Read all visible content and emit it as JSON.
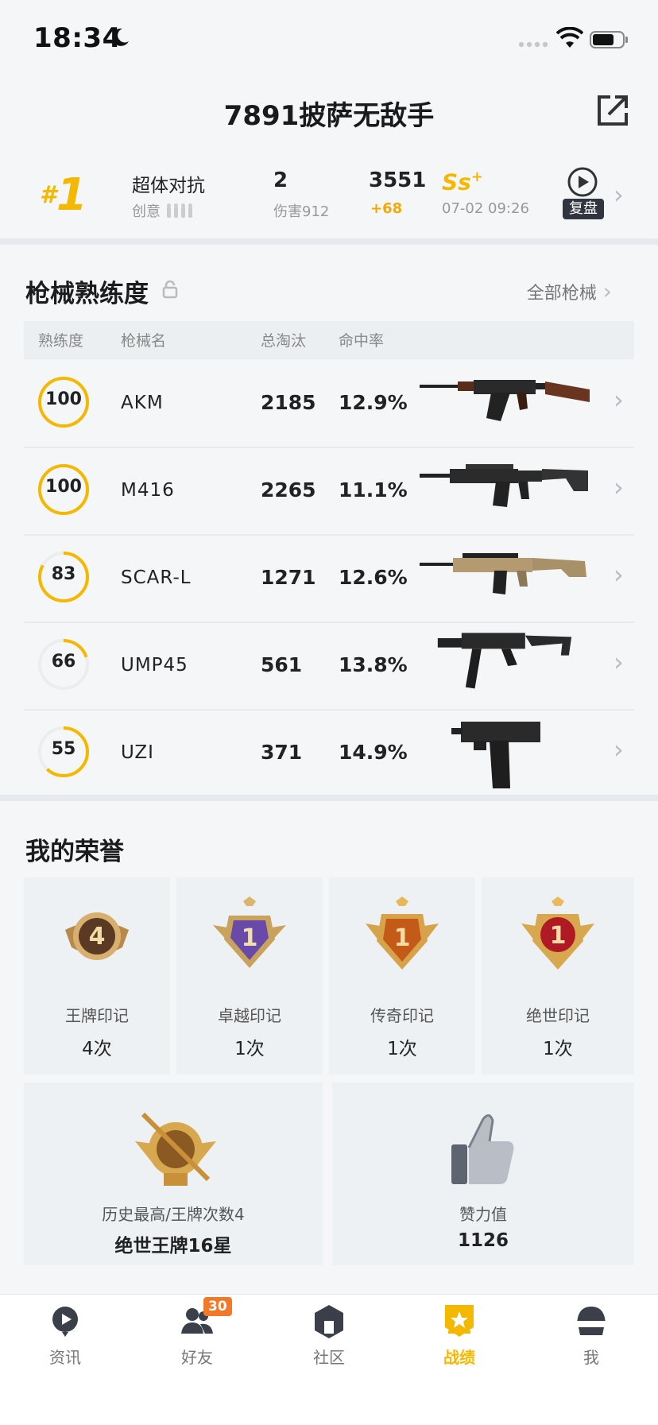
{
  "status_bar": {
    "time": "18:34"
  },
  "header": {
    "title": "7891披萨无敌手"
  },
  "latest_match": {
    "rank": "1",
    "mode": "超体对抗",
    "map": "创意",
    "kills": "2",
    "damage": "伤害912",
    "score": "3551",
    "score_delta": "+68",
    "grade": "Ss",
    "grade_plus": "+",
    "datetime": "07-02 09:26",
    "replay_label": "复盘"
  },
  "weapons": {
    "title": "枪械熟练度",
    "all_link": "全部枪械",
    "headers": [
      "熟练度",
      "枪械名",
      "总淘汰",
      "命中率"
    ],
    "rows": [
      {
        "level": "100",
        "level_fraction": 1.0,
        "name": "AKM",
        "kills": "2185",
        "accuracy": "12.9%"
      },
      {
        "level": "100",
        "level_fraction": 1.0,
        "name": "M416",
        "kills": "2265",
        "accuracy": "11.1%"
      },
      {
        "level": "83",
        "level_fraction": 0.83,
        "name": "SCAR-L",
        "kills": "1271",
        "accuracy": "12.6%"
      },
      {
        "level": "66",
        "level_fraction": 0.2,
        "name": "UMP45",
        "kills": "561",
        "accuracy": "13.8%"
      },
      {
        "level": "55",
        "level_fraction": 0.62,
        "name": "UZI",
        "kills": "371",
        "accuracy": "14.9%"
      }
    ]
  },
  "honors": {
    "title": "我的荣誉",
    "small": [
      {
        "label": "王牌印记",
        "value": "4次",
        "badge_text": "4",
        "icon": "ace-mark-badge"
      },
      {
        "label": "卓越印记",
        "value": "1次",
        "badge_text": "1",
        "icon": "excellence-mark-badge"
      },
      {
        "label": "传奇印记",
        "value": "1次",
        "badge_text": "1",
        "icon": "legend-mark-badge"
      },
      {
        "label": "绝世印记",
        "value": "1次",
        "badge_text": "1",
        "icon": "peerless-mark-badge"
      }
    ],
    "large": [
      {
        "label": "历史最高/王牌次数4",
        "value": "绝世王牌16星",
        "icon": "tier-emblem-badge"
      },
      {
        "label": "赞力值",
        "value": "1126",
        "icon": "thumbs-up-icon"
      }
    ]
  },
  "tabbar": {
    "tabs": [
      {
        "label": "资讯",
        "icon": "news-icon"
      },
      {
        "label": "好友",
        "icon": "friends-icon",
        "badge": "30"
      },
      {
        "label": "社区",
        "icon": "community-icon"
      },
      {
        "label": "战绩",
        "icon": "record-icon",
        "active": true
      },
      {
        "label": "我",
        "icon": "helmet-icon"
      }
    ]
  },
  "colors": {
    "accent": "#f5b800",
    "orange": "#f5a800",
    "background": "#f4f6f8"
  }
}
